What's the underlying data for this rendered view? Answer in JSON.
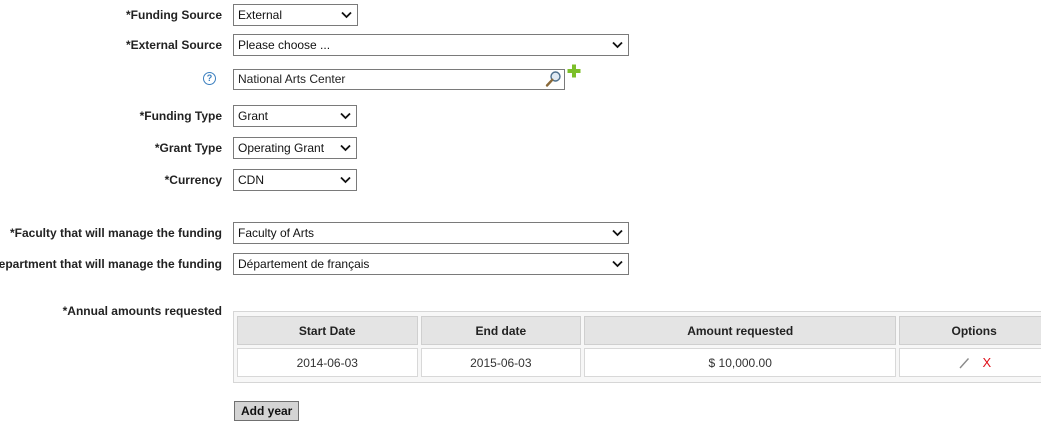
{
  "form": {
    "funding_source": {
      "label": "*Funding Source",
      "value": "External"
    },
    "external_source": {
      "label": "*External Source",
      "value": "Please choose ..."
    },
    "organization_lookup": {
      "value": "National Arts Center"
    },
    "funding_type": {
      "label": "*Funding Type",
      "value": "Grant"
    },
    "grant_type": {
      "label": "*Grant Type",
      "value": "Operating Grant"
    },
    "currency": {
      "label": "*Currency",
      "value": "CDN"
    },
    "faculty": {
      "label": "*Faculty that will manage the funding",
      "value": "Faculty of Arts"
    },
    "department": {
      "label": "Department that will manage the funding",
      "value": "Département de français"
    },
    "annual_amounts": {
      "label": "*Annual amounts requested"
    }
  },
  "table": {
    "headers": [
      "Start Date",
      "End date",
      "Amount requested",
      "Options"
    ],
    "rows": [
      {
        "start_date": "2014-06-03",
        "end_date": "2015-06-03",
        "amount": "$ 10,000.00",
        "delete_label": "X"
      }
    ]
  },
  "icons": {
    "help": "help-icon",
    "lookup": "magnifier-icon",
    "add": "plus-icon",
    "edit": "pencil-icon",
    "delete": "delete-x-icon"
  },
  "colors": {
    "add": "#7cbf2a",
    "delete": "#e0101a",
    "help": "#3b7fbf"
  },
  "add_year_button": "Add year",
  "help_glyph": "?"
}
